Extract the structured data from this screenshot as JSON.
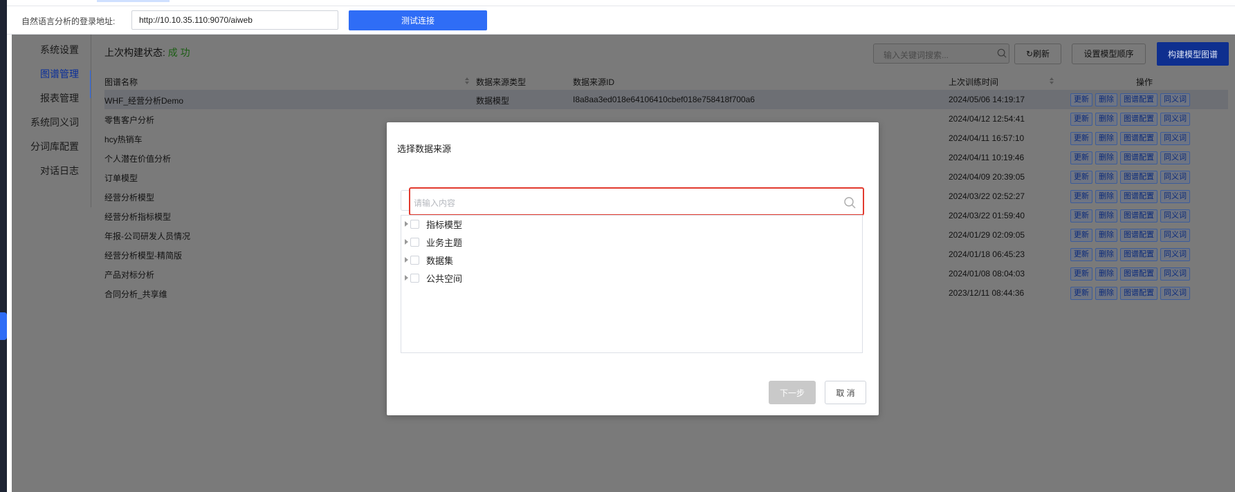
{
  "topbar": {
    "label": "自然语言分析的登录地址:",
    "url_value": "http://10.10.35.110:9070/aiweb",
    "test_button": "测试连接"
  },
  "sidebar": {
    "items": [
      {
        "label": "系统设置"
      },
      {
        "label": "图谱管理",
        "active": true
      },
      {
        "label": "报表管理"
      },
      {
        "label": "系统同义词"
      },
      {
        "label": "分词库配置"
      },
      {
        "label": "对话日志"
      }
    ]
  },
  "status": {
    "label": "上次构建状态:",
    "value": "成 功"
  },
  "toolbar": {
    "search_placeholder": "输入关键词搜索...",
    "refresh": "刷新",
    "set_order": "设置模型顺序",
    "build": "构建模型图谱"
  },
  "table": {
    "headers": {
      "name": "图谱名称",
      "source_type": "数据来源类型",
      "source_id": "数据来源ID",
      "last_time": "上次训练时间",
      "ops": "操作"
    },
    "op_labels": [
      "更新",
      "删除",
      "图谱配置",
      "同义词"
    ],
    "rows": [
      {
        "name": "WHF_经营分析Demo",
        "source_type": "数据模型",
        "source_id": "I8a8aa3ed018e64106410cbef018e758418f700a6",
        "last_time": "2024/05/06 14:19:17"
      },
      {
        "name": "零售客户分析",
        "source_type": "",
        "source_id": "",
        "last_time": "2024/04/12 12:54:41"
      },
      {
        "name": "hcy热销车",
        "source_type": "",
        "source_id": "",
        "last_time": "2024/04/11 16:57:10"
      },
      {
        "name": "个人潜在价值分析",
        "source_type": "",
        "source_id": "",
        "last_time": "2024/04/11 10:19:46"
      },
      {
        "name": "订单模型",
        "source_type": "",
        "source_id": "",
        "last_time": "2024/04/09 20:39:05"
      },
      {
        "name": "经营分析模型",
        "source_type": "",
        "source_id": "",
        "last_time": "2024/03/22 02:52:27"
      },
      {
        "name": "经营分析指标模型",
        "source_type": "",
        "source_id": "",
        "last_time": "2024/03/22 01:59:40"
      },
      {
        "name": "年报-公司研发人员情况",
        "source_type": "",
        "source_id": "",
        "last_time": "2024/01/29 02:09:05"
      },
      {
        "name": "经营分析模型-精简版",
        "source_type": "",
        "source_id": "",
        "last_time": "2024/01/18 06:45:23"
      },
      {
        "name": "产品对标分析",
        "source_type": "",
        "source_id": "",
        "last_time": "2024/01/08 08:04:03"
      },
      {
        "name": "合同分析_共享维",
        "source_type": "",
        "source_id": "",
        "last_time": "2023/12/11 08:44:36"
      }
    ]
  },
  "modal": {
    "title": "选择数据来源",
    "search_placeholder": "请输入内容",
    "tree": [
      "指标模型",
      "业务主题",
      "数据集",
      "公共空间"
    ],
    "next": "下一步",
    "cancel": "取 消"
  }
}
